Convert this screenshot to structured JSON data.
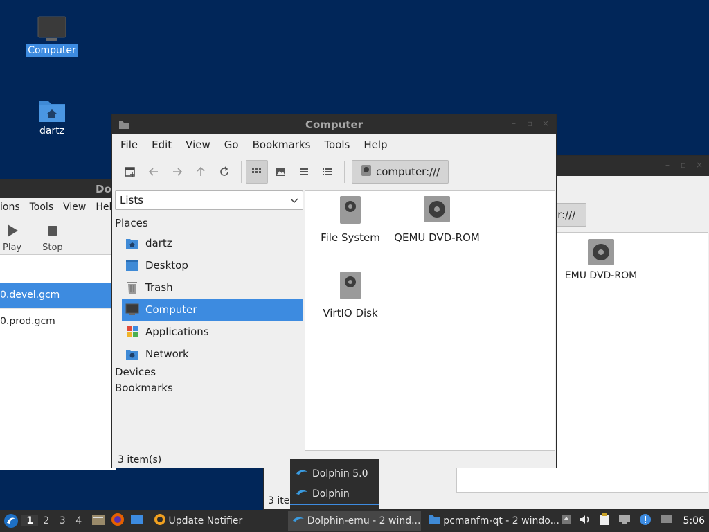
{
  "desktop": {
    "icons": [
      {
        "label": "Computer",
        "icon": "computer-icon",
        "selected": true
      },
      {
        "label": "dartz",
        "icon": "home-folder-icon",
        "selected": false
      }
    ]
  },
  "dolphin_window": {
    "title": "Do",
    "menu": [
      "ions",
      "Tools",
      "View",
      "Hel"
    ],
    "tools": [
      {
        "label": "Play",
        "icon": "play-icon"
      },
      {
        "label": "Stop",
        "icon": "stop-icon"
      }
    ],
    "rows": [
      {
        "label": "0.devel.gcm",
        "selected": true
      },
      {
        "label": "0.prod.gcm",
        "selected": false
      }
    ]
  },
  "pcmanfm_back": {
    "path": "er:///",
    "item": "EMU DVD-ROM",
    "status": "3 ite"
  },
  "main_window": {
    "title": "Computer",
    "menu": [
      "File",
      "Edit",
      "View",
      "Go",
      "Bookmarks",
      "Tools",
      "Help"
    ],
    "path": "computer:///",
    "side_combo": "Lists",
    "sections": {
      "places": "Places",
      "devices": "Devices",
      "bookmarks": "Bookmarks"
    },
    "places": [
      {
        "label": "dartz",
        "icon": "home-folder-icon",
        "selected": false
      },
      {
        "label": "Desktop",
        "icon": "desktop-icon",
        "selected": false
      },
      {
        "label": "Trash",
        "icon": "trash-icon",
        "selected": false
      },
      {
        "label": "Computer",
        "icon": "computer-icon",
        "selected": true
      },
      {
        "label": "Applications",
        "icon": "applications-icon",
        "selected": false
      },
      {
        "label": "Network",
        "icon": "network-folder-icon",
        "selected": false
      }
    ],
    "items": [
      {
        "label": "File System",
        "icon": "hard-disk-icon"
      },
      {
        "label": "QEMU DVD-ROM",
        "icon": "optical-drive-icon"
      },
      {
        "label": "VirtIO Disk",
        "icon": "hard-disk-icon"
      }
    ],
    "status": "3 item(s)"
  },
  "popup": {
    "items": [
      {
        "label": "Dolphin 5.0",
        "current": false
      },
      {
        "label": "Dolphin",
        "current": true
      }
    ]
  },
  "taskbar": {
    "desktops": [
      "1",
      "2",
      "3",
      "4"
    ],
    "tasks": [
      {
        "label": "Update Notifier",
        "icon": "update-notifier-icon",
        "active": false
      },
      {
        "label": "Dolphin-emu - 2 wind...",
        "icon": "dolphin-icon",
        "active": true
      },
      {
        "label": "pcmanfm-qt - 2 windo...",
        "icon": "folder-icon",
        "active": false
      }
    ],
    "clock": "5:06"
  }
}
